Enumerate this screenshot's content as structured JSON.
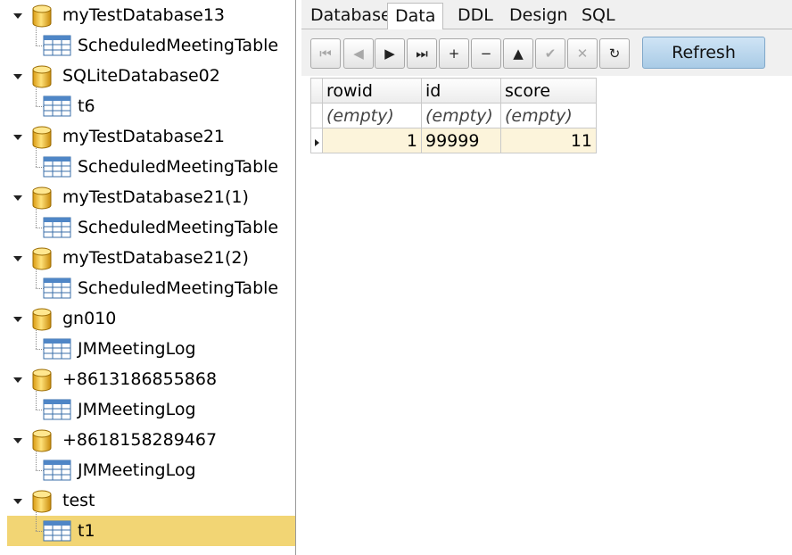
{
  "tree": {
    "nodes": [
      {
        "type": "db",
        "label": "myTestDatabase13"
      },
      {
        "type": "table",
        "label": "ScheduledMeetingTable"
      },
      {
        "type": "db",
        "label": "SQLiteDatabase02"
      },
      {
        "type": "table",
        "label": "t6"
      },
      {
        "type": "db",
        "label": "myTestDatabase21"
      },
      {
        "type": "table",
        "label": "ScheduledMeetingTable"
      },
      {
        "type": "db",
        "label": "myTestDatabase21(1)"
      },
      {
        "type": "table",
        "label": "ScheduledMeetingTable"
      },
      {
        "type": "db",
        "label": "myTestDatabase21(2)"
      },
      {
        "type": "table",
        "label": "ScheduledMeetingTable"
      },
      {
        "type": "db",
        "label": "gn010"
      },
      {
        "type": "table",
        "label": "JMMeetingLog"
      },
      {
        "type": "db",
        "label": "+8613186855868"
      },
      {
        "type": "table",
        "label": "JMMeetingLog"
      },
      {
        "type": "db",
        "label": "+8618158289467"
      },
      {
        "type": "table",
        "label": "JMMeetingLog"
      },
      {
        "type": "db",
        "label": "test"
      },
      {
        "type": "table",
        "label": "t1",
        "selected": true
      }
    ],
    "selected_color": "#f2d574"
  },
  "tabs": [
    {
      "label": "Database",
      "active": false
    },
    {
      "label": "Data",
      "active": true
    },
    {
      "label": "DDL",
      "active": false
    },
    {
      "label": "Design",
      "active": false
    },
    {
      "label": "SQL",
      "active": false
    }
  ],
  "toolbar": {
    "buttons": [
      {
        "icon": "first-record-icon",
        "glyph": "⏮",
        "enabled": false
      },
      {
        "icon": "prior-record-icon",
        "glyph": "◀",
        "enabled": false
      },
      {
        "icon": "next-record-icon",
        "glyph": "▶",
        "enabled": true
      },
      {
        "icon": "last-record-icon",
        "glyph": "⏭",
        "enabled": true
      },
      {
        "icon": "insert-record-icon",
        "glyph": "+",
        "enabled": true
      },
      {
        "icon": "delete-record-icon",
        "glyph": "−",
        "enabled": true
      },
      {
        "icon": "edit-record-icon",
        "glyph": "▲",
        "enabled": true
      },
      {
        "icon": "post-edit-icon",
        "glyph": "✔",
        "enabled": false
      },
      {
        "icon": "cancel-edit-icon",
        "glyph": "✕",
        "enabled": false
      },
      {
        "icon": "refresh-data-icon",
        "glyph": "↻",
        "enabled": true
      }
    ],
    "refresh_label": "Refresh"
  },
  "grid": {
    "columns": [
      "rowid",
      "id",
      "score"
    ],
    "filter": [
      "(empty)",
      "(empty)",
      "(empty)"
    ],
    "rows": [
      [
        "1",
        "99999",
        "11"
      ]
    ],
    "row_color": "#fcf4db"
  }
}
